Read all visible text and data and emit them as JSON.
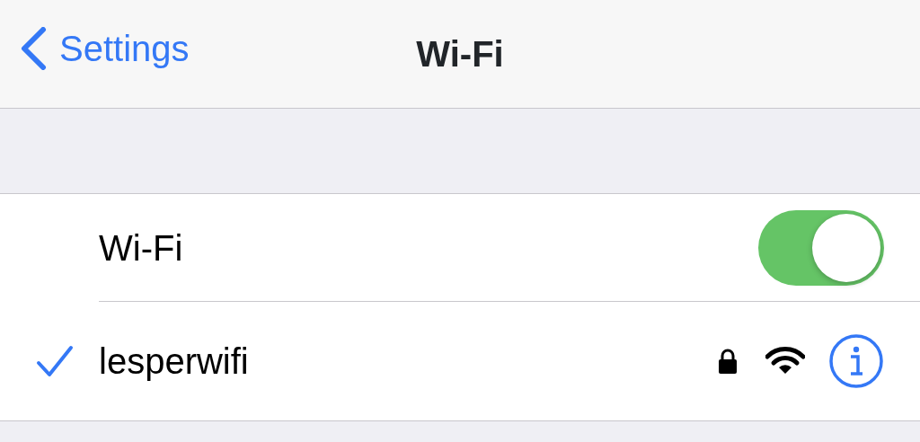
{
  "nav": {
    "back_label": "Settings",
    "title": "Wi-Fi"
  },
  "wifi_switch": {
    "label": "Wi-Fi",
    "on": true
  },
  "networks": [
    {
      "name": "lesperwifi",
      "selected": true,
      "secured": true
    }
  ]
}
